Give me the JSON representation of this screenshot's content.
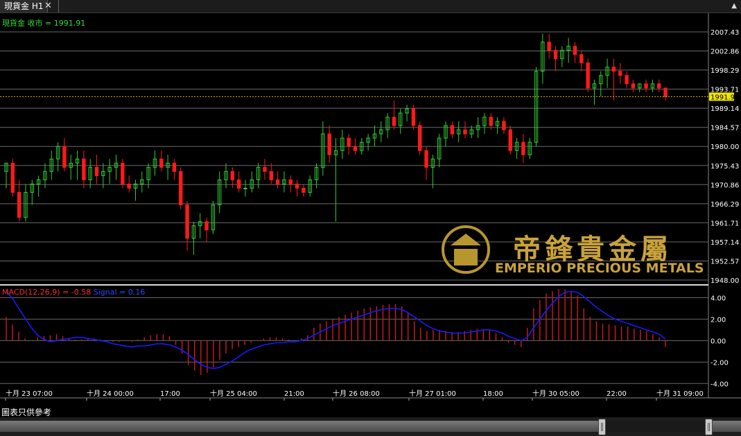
{
  "window": {
    "tab_title": "現貨金 H1",
    "close_glyph": "✕",
    "menu_glyph": "▲"
  },
  "note": "圖表只供參考",
  "colors": {
    "up": "#33cc33",
    "down": "#ff1a1a",
    "macd_hist": "#d41a1a",
    "signal": "#1a1aff",
    "grid": "#6a6a6a",
    "current_line": "#e6a800",
    "current_label_bg": "#f2e600"
  },
  "chart_data": [
    {
      "type": "candlestick",
      "title": "現貨金 收市 = 1991.91",
      "current_price": 1991.91,
      "y_ticks": [
        "2007.43",
        "2002.86",
        "1998.29",
        "1993.71",
        "1989.14",
        "1984.57",
        "1980.00",
        "1975.43",
        "1970.86",
        "1966.29",
        "1961.71",
        "1957.14",
        "1952.57",
        "1948.00"
      ],
      "ylim": [
        1948.0,
        2007.43
      ],
      "x_ticks": [
        "十月 23 07:00",
        "十月 24 00:00",
        "17:00",
        "十月 25 04:00",
        "21:00",
        "十月 26 08:00",
        "十月 27 01:00",
        "18:00",
        "十月 30 05:00",
        "22:00",
        "十月 31 09:00"
      ],
      "watermark": {
        "cn": "帝鋒貴金屬",
        "en": "EMPERIO PRECIOUS METALS"
      },
      "candles": [
        [
          1974,
          1976,
          1970,
          1976
        ],
        [
          1976,
          1977,
          1968,
          1969
        ],
        [
          1969,
          1972,
          1962,
          1963
        ],
        [
          1963,
          1971,
          1962,
          1969
        ],
        [
          1969,
          1972,
          1966,
          1971
        ],
        [
          1971,
          1973,
          1968,
          1972
        ],
        [
          1972,
          1976,
          1970,
          1974
        ],
        [
          1974,
          1979,
          1972,
          1977
        ],
        [
          1977,
          1981,
          1974,
          1980
        ],
        [
          1980,
          1982,
          1974,
          1975
        ],
        [
          1975,
          1978,
          1972,
          1976
        ],
        [
          1976,
          1979,
          1972,
          1977
        ],
        [
          1977,
          1979,
          1970,
          1972
        ],
        [
          1972,
          1977,
          1970,
          1975
        ],
        [
          1975,
          1978,
          1971,
          1973
        ],
        [
          1973,
          1976,
          1970,
          1974
        ],
        [
          1974,
          1977,
          1971,
          1975
        ],
        [
          1975,
          1978,
          1972,
          1976
        ],
        [
          1976,
          1977,
          1970,
          1971
        ],
        [
          1971,
          1973,
          1969,
          1970
        ],
        [
          1970,
          1972,
          1967,
          1971
        ],
        [
          1971,
          1974,
          1969,
          1972
        ],
        [
          1972,
          1976,
          1970,
          1975
        ],
        [
          1975,
          1979,
          1973,
          1977
        ],
        [
          1977,
          1979,
          1974,
          1975
        ],
        [
          1975,
          1978,
          1972,
          1976
        ],
        [
          1976,
          1977,
          1972,
          1974
        ],
        [
          1974,
          1975,
          1965,
          1966
        ],
        [
          1966,
          1967,
          1955,
          1958
        ],
        [
          1958,
          1962,
          1954,
          1961
        ],
        [
          1961,
          1964,
          1958,
          1962
        ],
        [
          1962,
          1963,
          1957,
          1960
        ],
        [
          1960,
          1967,
          1959,
          1966
        ],
        [
          1966,
          1974,
          1964,
          1972
        ],
        [
          1972,
          1976,
          1970,
          1974
        ],
        [
          1974,
          1975,
          1970,
          1972
        ],
        [
          1972,
          1974,
          1969,
          1970
        ],
        [
          1970,
          1972,
          1968,
          1970
        ],
        [
          1970,
          1974,
          1969,
          1972
        ],
        [
          1972,
          1976,
          1970,
          1975
        ],
        [
          1975,
          1977,
          1972,
          1974
        ],
        [
          1974,
          1976,
          1971,
          1972
        ],
        [
          1972,
          1974,
          1970,
          1971
        ],
        [
          1971,
          1974,
          1969,
          1972
        ],
        [
          1972,
          1973,
          1969,
          1971
        ],
        [
          1971,
          1972,
          1968,
          1970
        ],
        [
          1970,
          1971,
          1968,
          1969
        ],
        [
          1969,
          1973,
          1968,
          1972
        ],
        [
          1972,
          1976,
          1970,
          1975
        ],
        [
          1975,
          1986,
          1973,
          1983
        ],
        [
          1983,
          1985,
          1976,
          1978
        ],
        [
          1978,
          1982,
          1962,
          1979
        ],
        [
          1979,
          1984,
          1977,
          1982
        ],
        [
          1982,
          1983,
          1978,
          1980
        ],
        [
          1980,
          1982,
          1978,
          1979
        ],
        [
          1979,
          1982,
          1978,
          1981
        ],
        [
          1981,
          1983,
          1979,
          1982
        ],
        [
          1982,
          1985,
          1980,
          1983
        ],
        [
          1983,
          1986,
          1981,
          1984
        ],
        [
          1984,
          1988,
          1982,
          1987
        ],
        [
          1987,
          1991,
          1984,
          1985
        ],
        [
          1985,
          1989,
          1983,
          1988
        ],
        [
          1988,
          1990,
          1986,
          1989
        ],
        [
          1989,
          1990,
          1984,
          1985
        ],
        [
          1985,
          1986,
          1978,
          1979
        ],
        [
          1979,
          1980,
          1972,
          1975
        ],
        [
          1975,
          1978,
          1970,
          1977
        ],
        [
          1977,
          1983,
          1975,
          1982
        ],
        [
          1982,
          1986,
          1980,
          1985
        ],
        [
          1985,
          1986,
          1982,
          1983
        ],
        [
          1983,
          1986,
          1981,
          1984
        ],
        [
          1984,
          1986,
          1982,
          1983
        ],
        [
          1983,
          1985,
          1982,
          1984
        ],
        [
          1984,
          1987,
          1982,
          1985
        ],
        [
          1985,
          1988,
          1983,
          1987
        ],
        [
          1987,
          1988,
          1984,
          1985
        ],
        [
          1985,
          1987,
          1983,
          1986
        ],
        [
          1986,
          1987,
          1983,
          1984
        ],
        [
          1984,
          1985,
          1978,
          1979
        ],
        [
          1979,
          1982,
          1977,
          1981
        ],
        [
          1981,
          1983,
          1976,
          1978
        ],
        [
          1978,
          1982,
          1977,
          1981
        ],
        [
          1981,
          1999,
          1980,
          1998
        ],
        [
          1998,
          2007,
          1995,
          2005
        ],
        [
          2005,
          2007,
          2001,
          2003
        ],
        [
          2003,
          2004,
          1998,
          2001
        ],
        [
          2001,
          2004,
          1999,
          2003
        ],
        [
          2003,
          2006,
          2000,
          2004
        ],
        [
          2004,
          2005,
          2000,
          2002
        ],
        [
          2002,
          2003,
          1998,
          2000
        ],
        [
          2000,
          2001,
          1993,
          1994
        ],
        [
          1994,
          1996,
          1990,
          1995
        ],
        [
          1995,
          1998,
          1992,
          1997
        ],
        [
          1997,
          2001,
          1994,
          1999
        ],
        [
          1999,
          2001,
          1991,
          1998
        ],
        [
          1998,
          2000,
          1995,
          1997
        ],
        [
          1997,
          1998,
          1994,
          1995
        ],
        [
          1995,
          1996,
          1993,
          1994
        ],
        [
          1994,
          1995,
          1993,
          1995
        ],
        [
          1995,
          1996,
          1993,
          1994
        ],
        [
          1994,
          1996,
          1993,
          1995
        ],
        [
          1995,
          1996,
          1993,
          1994
        ],
        [
          1994,
          1994,
          1991,
          1991.91
        ]
      ],
      "candles_fields": [
        "open",
        "high",
        "low",
        "close"
      ]
    },
    {
      "type": "bar+line",
      "title": "MACD(12,26,9) = -0.58",
      "signal_label": "Signal = 0.16",
      "params": [
        12,
        26,
        9
      ],
      "y_ticks": [
        "4.00",
        "2.00",
        "0.00",
        "-2.00",
        "-4.00"
      ],
      "ylim": [
        -4.5,
        5.0
      ],
      "histogram": [
        2.2,
        1.5,
        0.8,
        0.2,
        0.0,
        0.3,
        0.4,
        0.5,
        0.6,
        0.4,
        0.2,
        0.1,
        0.1,
        0.2,
        0.2,
        0.1,
        0.0,
        -0.1,
        -0.1,
        0.0,
        -0.1,
        0.1,
        0.3,
        0.5,
        0.6,
        0.6,
        0.4,
        -0.4,
        -1.2,
        -2.3,
        -2.8,
        -3.2,
        -3.0,
        -2.5,
        -1.8,
        -1.2,
        -0.8,
        -0.6,
        -0.4,
        -0.2,
        0.0,
        0.2,
        0.3,
        0.3,
        0.2,
        0.1,
        0.0,
        0.2,
        0.5,
        1.2,
        1.6,
        1.8,
        2.0,
        2.2,
        2.4,
        2.6,
        2.8,
        3.0,
        3.1,
        3.2,
        3.3,
        3.4,
        3.4,
        3.2,
        2.6,
        1.8,
        1.2,
        0.9,
        1.0,
        1.0,
        0.9,
        0.8,
        0.8,
        0.9,
        1.0,
        1.1,
        1.1,
        1.0,
        0.7,
        0.3,
        -0.2,
        -0.4,
        -0.6,
        1.2,
        3.0,
        3.8,
        4.4,
        4.6,
        4.8,
        4.8,
        4.6,
        4.2,
        3.0,
        2.2,
        1.8,
        1.6,
        1.5,
        1.4,
        1.3,
        1.3,
        1.1,
        1.0,
        0.9,
        0.6,
        0.3,
        -0.6
      ],
      "signal": [
        4.6,
        3.9,
        3.0,
        2.1,
        1.2,
        0.5,
        0.1,
        -0.1,
        0.0,
        0.1,
        0.2,
        0.3,
        0.3,
        0.2,
        0.1,
        0.0,
        -0.1,
        -0.3,
        -0.4,
        -0.5,
        -0.6,
        -0.5,
        -0.5,
        -0.4,
        -0.3,
        -0.3,
        -0.4,
        -0.6,
        -0.9,
        -1.3,
        -1.8,
        -2.2,
        -2.5,
        -2.6,
        -2.5,
        -2.2,
        -1.9,
        -1.5,
        -1.1,
        -0.8,
        -0.6,
        -0.4,
        -0.3,
        -0.2,
        -0.2,
        -0.1,
        -0.1,
        0.0,
        0.2,
        0.5,
        0.8,
        1.1,
        1.4,
        1.6,
        1.8,
        2.0,
        2.2,
        2.4,
        2.6,
        2.8,
        2.9,
        3.0,
        3.0,
        2.9,
        2.6,
        2.2,
        1.8,
        1.4,
        1.1,
        0.9,
        0.8,
        0.7,
        0.7,
        0.7,
        0.8,
        0.9,
        1.0,
        1.0,
        0.9,
        0.7,
        0.4,
        0.2,
        0.0,
        0.3,
        1.2,
        2.0,
        2.8,
        3.5,
        4.1,
        4.5,
        4.6,
        4.5,
        4.1,
        3.6,
        3.1,
        2.7,
        2.3,
        2.0,
        1.8,
        1.6,
        1.4,
        1.2,
        1.0,
        0.8,
        0.6,
        0.16
      ]
    }
  ]
}
